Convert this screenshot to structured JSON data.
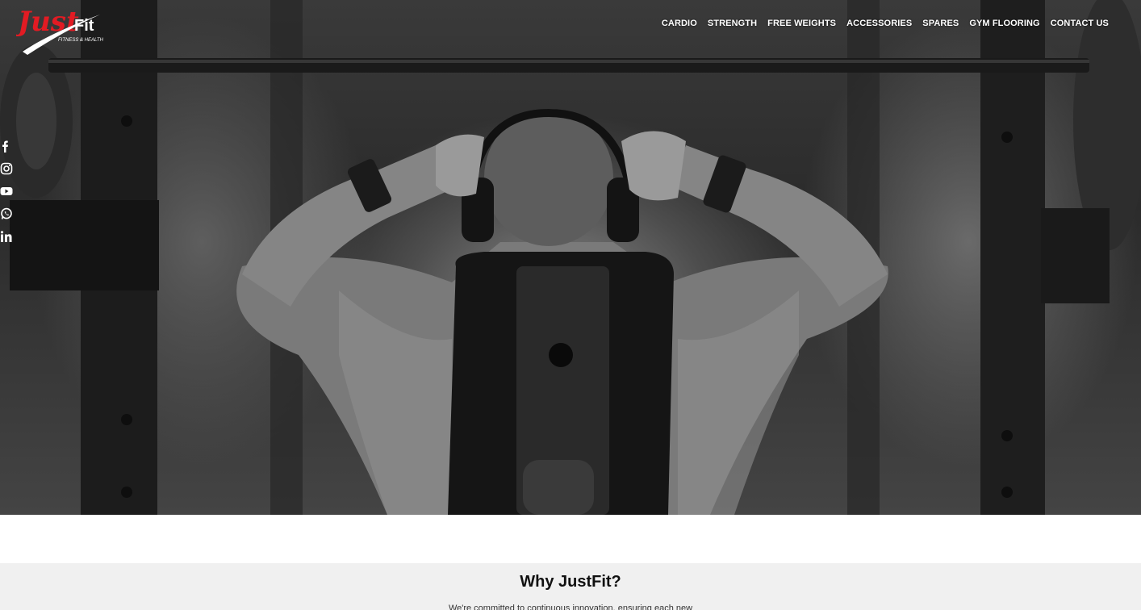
{
  "brand": {
    "logo_script": "Just",
    "logo_word": "Fit",
    "tagline": "FITNESS & HEALTH",
    "accent_color": "#e21b23"
  },
  "nav": {
    "items": [
      {
        "label": "CARDIO"
      },
      {
        "label": "STRENGTH"
      },
      {
        "label": "FREE WEIGHTS"
      },
      {
        "label": "ACCESSORIES"
      },
      {
        "label": "SPARES"
      },
      {
        "label": "GYM FLOORING"
      },
      {
        "label": "CONTACT US"
      }
    ]
  },
  "social": [
    "facebook-icon",
    "instagram-icon",
    "youtube-icon",
    "whatsapp-icon",
    "linkedin-icon"
  ],
  "hero": {
    "image_subject": "gym-barbell-photo"
  },
  "why": {
    "title": "Why JustFit?",
    "intro": "We're committed to continuous innovation, ensuring each new"
  }
}
